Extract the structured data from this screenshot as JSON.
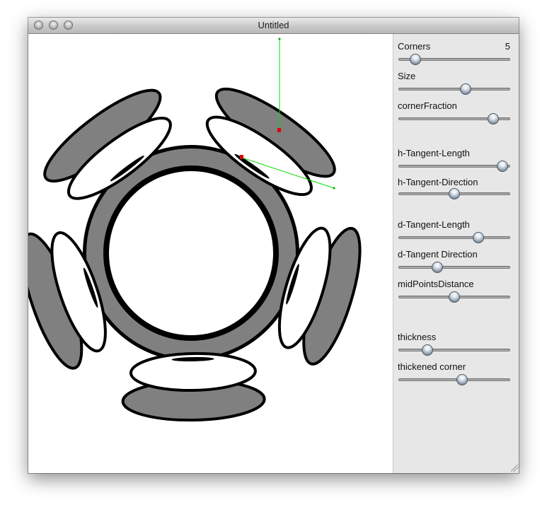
{
  "window": {
    "title": "Untitled"
  },
  "controls": {
    "corners": {
      "label": "Corners",
      "value": "5",
      "level": 0.11
    },
    "size": {
      "label": "Size",
      "level": 0.61
    },
    "corner_fraction": {
      "label": "cornerFraction",
      "level": 0.89
    },
    "h_tangent_length": {
      "label": "h-Tangent-Length",
      "level": 0.98
    },
    "h_tangent_direction": {
      "label": "h-Tangent-Direction",
      "level": 0.5
    },
    "d_tangent_length": {
      "label": "d-Tangent-Length",
      "level": 0.74
    },
    "d_tangent_direction": {
      "label": "d-Tangent Direction",
      "level": 0.33
    },
    "mid_points_distance": {
      "label": "midPointsDistance",
      "level": 0.5
    },
    "thickness": {
      "label": "thickness",
      "level": 0.23
    },
    "thickened_corner": {
      "label": "thickened corner",
      "level": 0.58
    }
  },
  "colors": {
    "shape_fill": "#808080",
    "outline": "#000000",
    "tangent_line": "#00dd00",
    "control_point": "#dd0000"
  }
}
